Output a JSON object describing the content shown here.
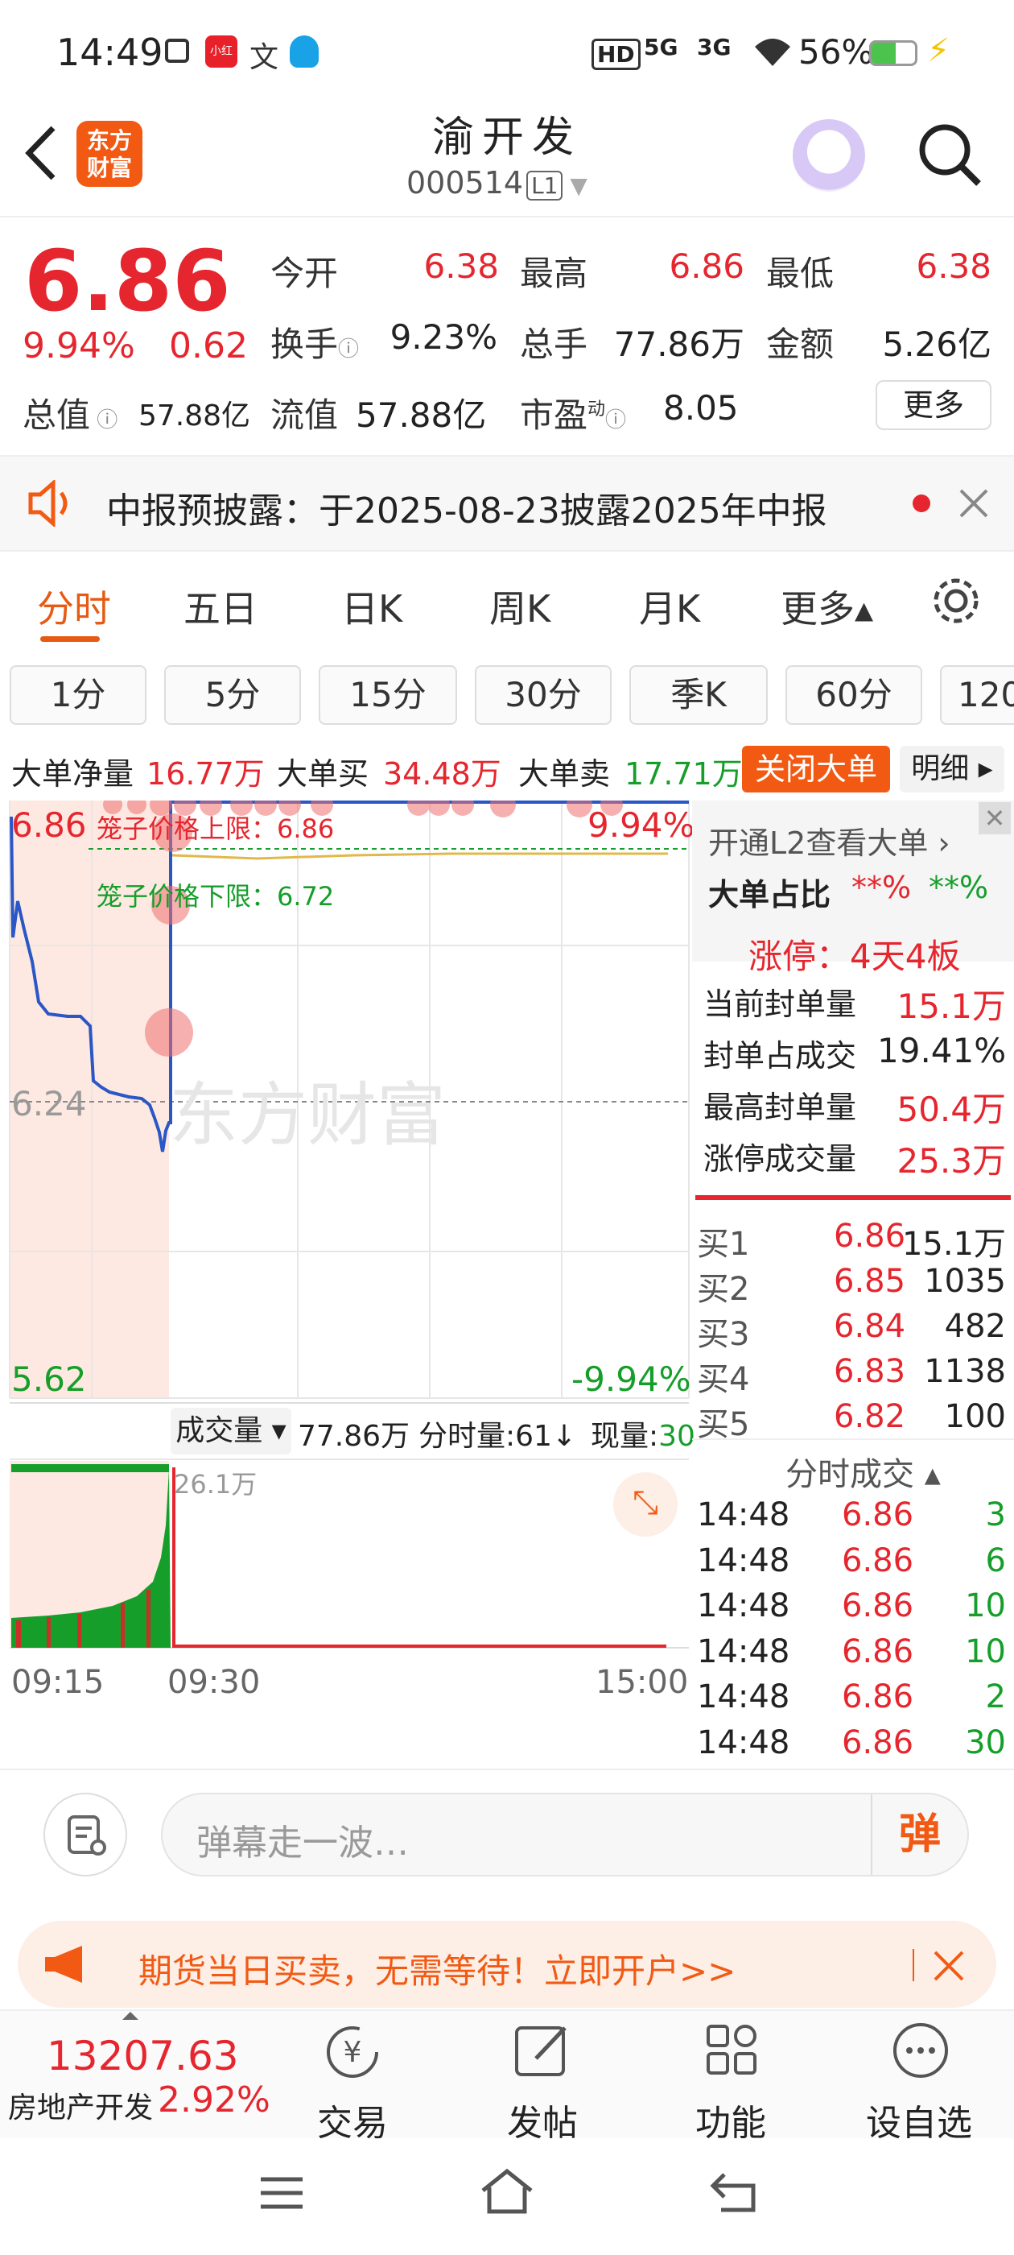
{
  "status": {
    "time": "14:49",
    "notif_icons": [
      "notification-icon",
      "xiaohongshu-icon",
      "translate-icon",
      "qq-icon"
    ],
    "hd": "HD",
    "net1": "5G",
    "net2": "3G",
    "battery": "56%"
  },
  "header": {
    "logo_line1": "东方",
    "logo_line2": "财富",
    "title": "渝开发",
    "code": "000514",
    "level": "L1"
  },
  "quote": {
    "price": "6.86",
    "pct": "9.94%",
    "change": "0.62",
    "jinkai_label": "今开",
    "jinkai": "6.38",
    "zuigao_label": "最高",
    "zuigao": "6.86",
    "zuidi_label": "最低",
    "zuidi": "6.38",
    "huanshou_label": "换手",
    "huanshou": "9.23%",
    "zongshou_label": "总手",
    "zongshou": "77.86万",
    "jine_label": "金额",
    "jine": "5.26亿",
    "zongzhi_label": "总值",
    "zongzhi": "57.88亿",
    "liuzhi_label": "流值",
    "liuzhi": "57.88亿",
    "shiying_label": "市盈",
    "shiying_sup": "动",
    "shiying": "8.05",
    "more": "更多"
  },
  "notice": {
    "text": "中报预披露：于2025-08-23披露2025年中报"
  },
  "tabs": [
    "分时",
    "五日",
    "日K",
    "周K",
    "月K",
    "更多▴"
  ],
  "periods": [
    "1分",
    "5分",
    "15分",
    "30分",
    "季K",
    "60分",
    "120"
  ],
  "l2": {
    "net_label": "大单净量",
    "net": "16.77万",
    "buy_label": "大单买",
    "buy": "34.48万",
    "sell_label": "大单卖",
    "sell": "17.71万",
    "close": "关闭大单",
    "detail": "明细 ▸"
  },
  "chart": {
    "top_price": "6.86",
    "top_pct": "9.94%",
    "mid_price": "6.24",
    "bottom_price": "5.62",
    "bottom_pct": "-9.94%",
    "upper_limit": "笼子价格上限：6.86",
    "lower_limit": "笼子价格下限：6.72",
    "watermark": "东方财富",
    "vol_label": "成交量 ▾",
    "vol_total": "77.86万",
    "vol_min": "分时量:61↓",
    "vol_now_label": "现量:",
    "vol_now": "30",
    "vol_peak": "26.1万",
    "time_start": "09:15",
    "time_open": "09:30",
    "time_end": "15:00"
  },
  "panel": {
    "l2_link": "开通L2查看大单 ›",
    "ratio_label": "大单占比",
    "ratio_buy": "**%",
    "ratio_sell": "**%",
    "limit_title": "涨停：4天4板",
    "stats": [
      {
        "label": "当前封单量",
        "value": "15.1万",
        "color": "#e6262e"
      },
      {
        "label": "封单占成交",
        "value": "19.41%",
        "color": "#222"
      },
      {
        "label": "最高封单量",
        "value": "50.4万",
        "color": "#e6262e"
      },
      {
        "label": "涨停成交量",
        "value": "25.3万",
        "color": "#e6262e"
      }
    ],
    "book": [
      {
        "label": "买1",
        "price": "6.86",
        "vol": "15.1万"
      },
      {
        "label": "买2",
        "price": "6.85",
        "vol": "1035"
      },
      {
        "label": "买3",
        "price": "6.84",
        "vol": "482"
      },
      {
        "label": "买4",
        "price": "6.83",
        "vol": "1138"
      },
      {
        "label": "买5",
        "price": "6.82",
        "vol": "100"
      }
    ],
    "ticks_title": "分时成交 ▴",
    "ticks": [
      {
        "t": "14:48",
        "p": "6.86",
        "v": "3"
      },
      {
        "t": "14:48",
        "p": "6.86",
        "v": "6"
      },
      {
        "t": "14:48",
        "p": "6.86",
        "v": "10"
      },
      {
        "t": "14:48",
        "p": "6.86",
        "v": "10"
      },
      {
        "t": "14:48",
        "p": "6.86",
        "v": "2"
      },
      {
        "t": "14:48",
        "p": "6.86",
        "v": "30"
      }
    ]
  },
  "danmu": {
    "placeholder": "弹幕走一波…",
    "send": "弹"
  },
  "ad": {
    "text": "期货当日买卖，无需等待！立即开户>>"
  },
  "bottom": {
    "index": "13207.63",
    "sector": "房地产开发",
    "sector_pct": "2.92%",
    "items": [
      "交易",
      "发帖",
      "功能",
      "设自选"
    ]
  }
}
